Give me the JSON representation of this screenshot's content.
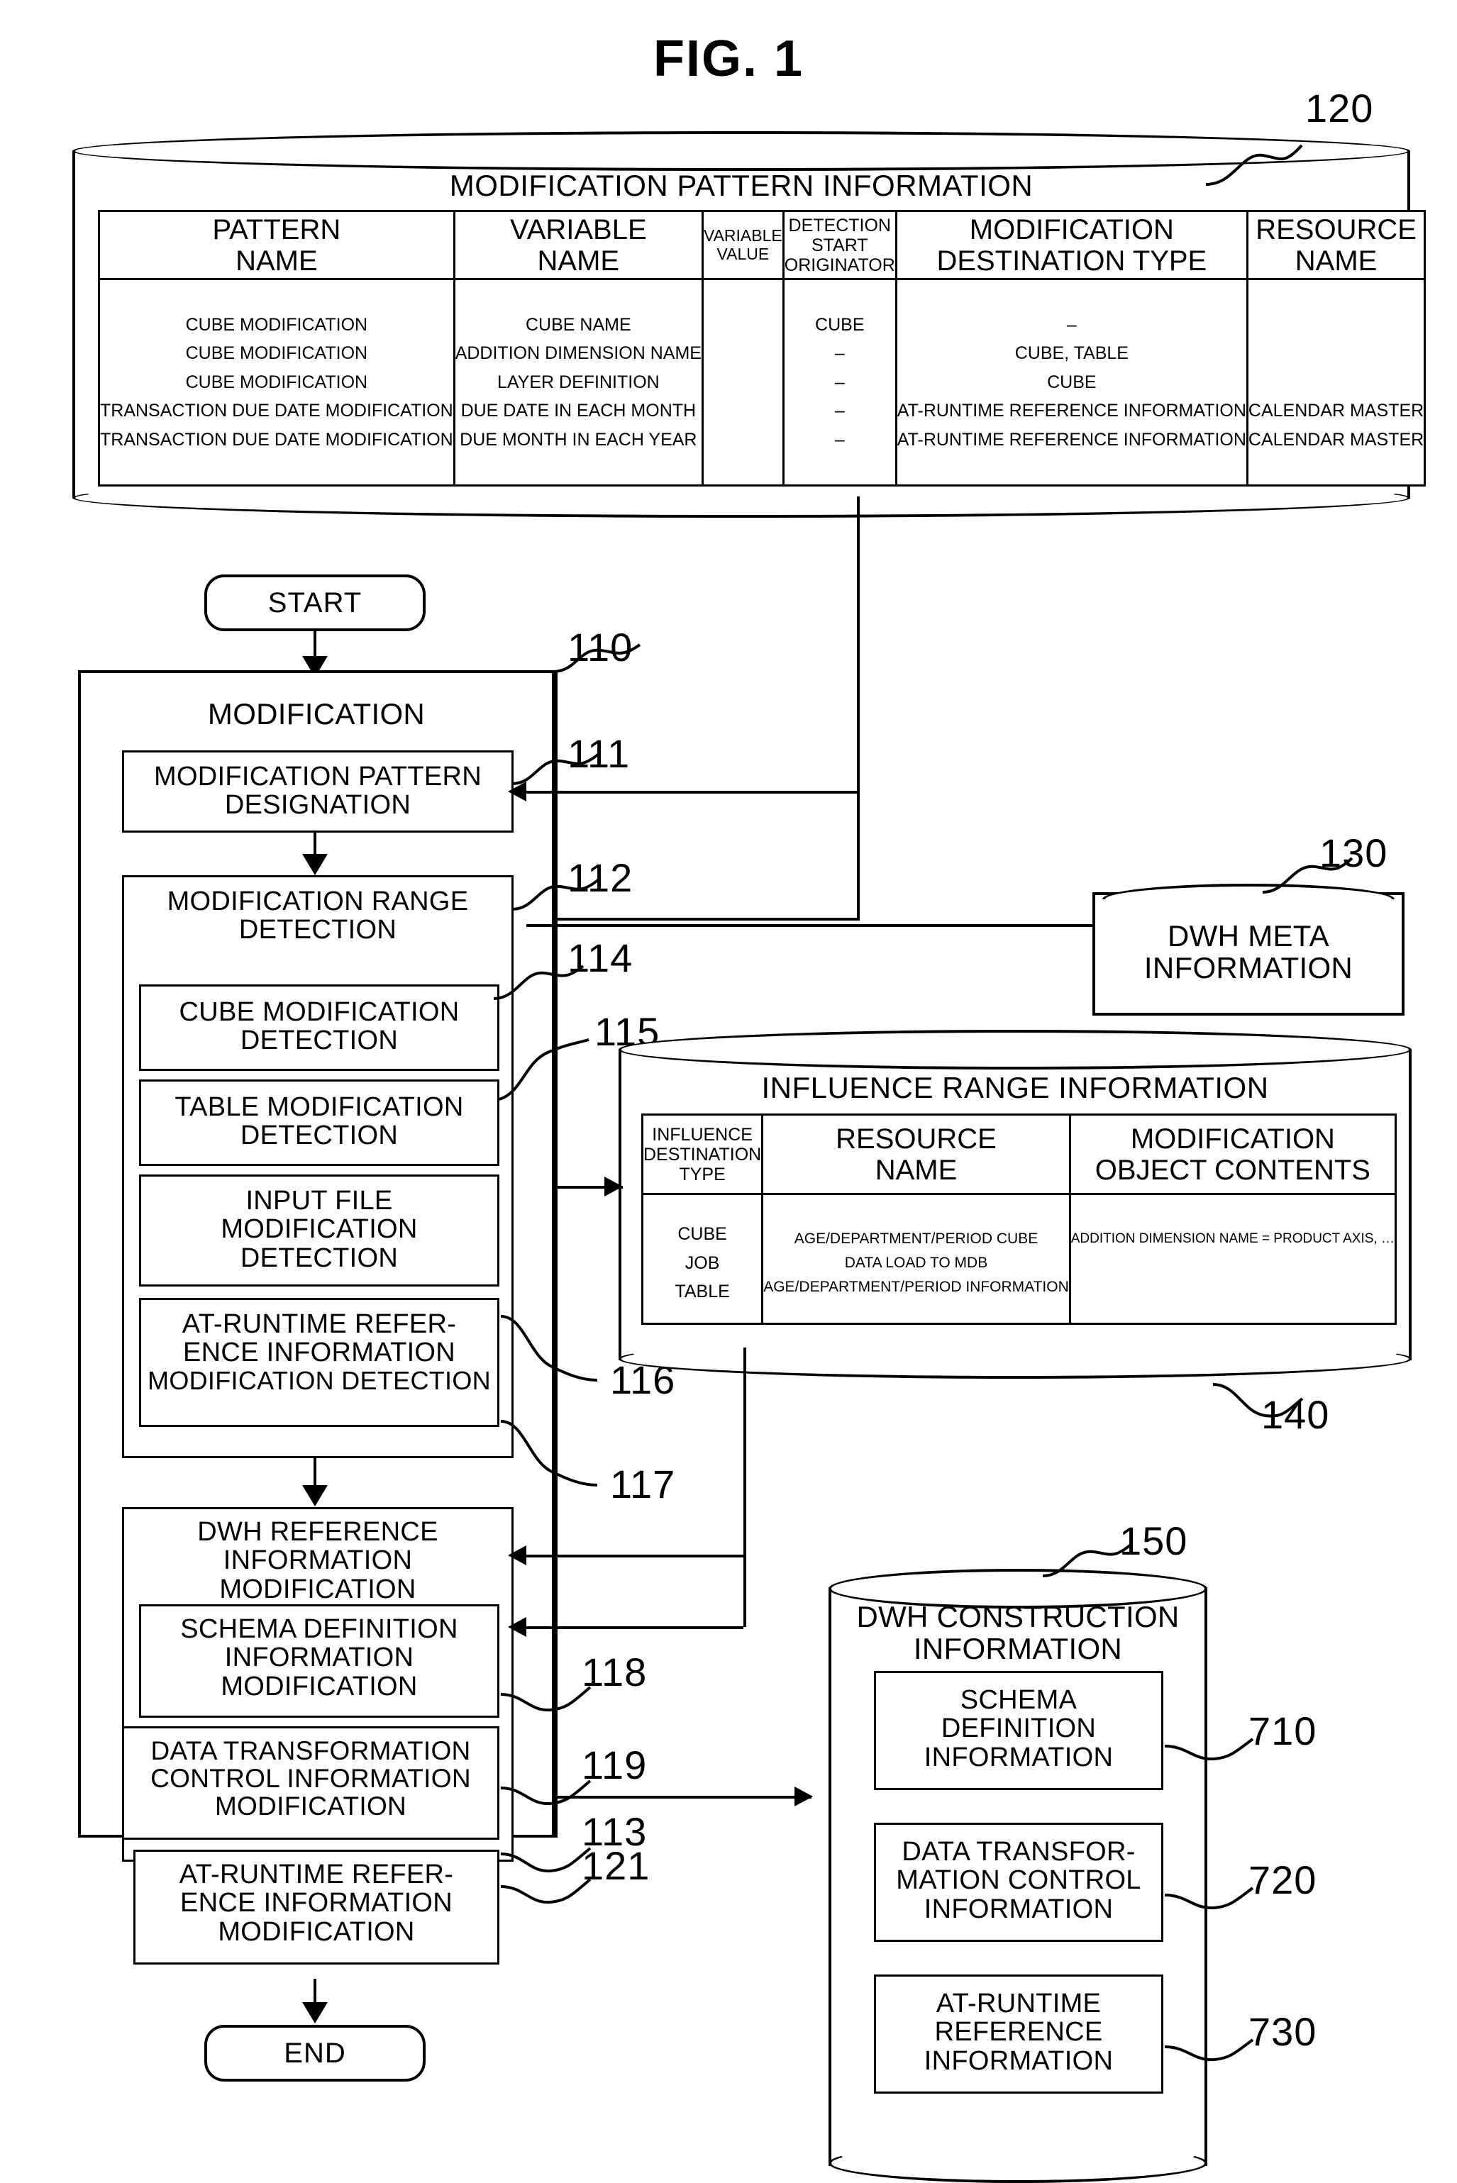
{
  "figure": {
    "title": "FIG. 1"
  },
  "modification_pattern_store": {
    "ref": "120",
    "title": "MODIFICATION PATTERN INFORMATION",
    "columns": [
      "PATTERN NAME",
      "VARIABLE NAME",
      "VARIABLE VALUE",
      "DETECTION START ORIGINATOR",
      "MODIFICATION DESTINATION TYPE",
      "RESOURCE NAME"
    ],
    "columns_split": [
      {
        "l1": "PATTERN",
        "l2": "NAME"
      },
      {
        "l1": "VARIABLE",
        "l2": "NAME"
      },
      {
        "l1": "VARIABLE",
        "l2": "VALUE"
      },
      {
        "l1": "DETECTION START",
        "l2": "ORIGINATOR"
      },
      {
        "l1": "MODIFICATION",
        "l2": "DESTINATION TYPE"
      },
      {
        "l1": "RESOURCE",
        "l2": "NAME"
      }
    ],
    "rows": [
      {
        "pattern_name": "CUBE MODIFICATION",
        "variable_name": "CUBE NAME",
        "variable_value": "",
        "detection_start_originator": "CUBE",
        "modification_destination_type": "–",
        "resource_name": ""
      },
      {
        "pattern_name": "CUBE MODIFICATION",
        "variable_name": "ADDITION DIMENSION NAME",
        "variable_value": "",
        "detection_start_originator": "–",
        "modification_destination_type": "CUBE, TABLE",
        "resource_name": ""
      },
      {
        "pattern_name": "CUBE MODIFICATION",
        "variable_name": "LAYER DEFINITION",
        "variable_value": "",
        "detection_start_originator": "–",
        "modification_destination_type": "CUBE",
        "resource_name": ""
      },
      {
        "pattern_name": "TRANSACTION DUE DATE MODIFICATION",
        "variable_name": "DUE DATE IN EACH MONTH",
        "variable_value": "",
        "detection_start_originator": "–",
        "modification_destination_type": "AT-RUNTIME REFERENCE INFORMATION",
        "resource_name": "CALENDAR MASTER"
      },
      {
        "pattern_name": "TRANSACTION DUE DATE MODIFICATION",
        "variable_name": "DUE MONTH IN EACH YEAR",
        "variable_value": "",
        "detection_start_originator": "–",
        "modification_destination_type": "AT-RUNTIME REFERENCE INFORMATION",
        "resource_name": "CALENDAR MASTER"
      }
    ]
  },
  "flow": {
    "start_label": "START",
    "end_label": "END",
    "modification_process": {
      "ref": "110",
      "title": "MODIFICATION",
      "steps": [
        {
          "ref": "111",
          "label_l1": "MODIFICATION PATTERN",
          "label_l2": "DESIGNATION"
        },
        {
          "ref": "112",
          "label_l1": "MODIFICATION RANGE",
          "label_l2": "DETECTION"
        }
      ],
      "detection_substeps": [
        {
          "ref": "114",
          "lines": [
            "CUBE MODIFICATION",
            "DETECTION"
          ]
        },
        {
          "ref": "115",
          "lines": [
            "TABLE MODIFICATION",
            "DETECTION"
          ]
        },
        {
          "ref": "116",
          "lines": [
            "INPUT FILE",
            "MODIFICATION",
            "DETECTION"
          ]
        },
        {
          "ref": "117",
          "lines": [
            "AT-RUNTIME REFER-",
            "ENCE INFORMATION",
            "MODIFICATION DETECTION"
          ]
        }
      ],
      "dwh_reference_modification": {
        "ref": "113",
        "lines": [
          "DWH REFERENCE",
          "INFORMATION",
          "MODIFICATION"
        ],
        "substeps": [
          {
            "ref": "118",
            "lines": [
              "SCHEMA DEFINITION",
              "INFORMATION",
              "MODIFICATION"
            ]
          },
          {
            "ref": "119",
            "lines": [
              "DATA TRANSFORMATION",
              "CONTROL INFORMATION",
              "MODIFICATION"
            ]
          },
          {
            "ref": "121",
            "lines": [
              "AT-RUNTIME REFER-",
              "ENCE INFORMATION",
              "MODIFICATION"
            ]
          }
        ]
      }
    }
  },
  "dwh_meta": {
    "ref": "130",
    "lines": [
      "DWH META",
      "INFORMATION"
    ]
  },
  "influence_range_store": {
    "ref": "140",
    "title": "INFLUENCE RANGE INFORMATION",
    "columns_split": [
      {
        "l1": "INFLUENCE",
        "l2": "DESTINATION TYPE"
      },
      {
        "l1": "RESOURCE",
        "l2": "NAME"
      },
      {
        "l1": "MODIFICATION",
        "l2": "OBJECT CONTENTS"
      }
    ],
    "rows": [
      {
        "influence_destination_type": "CUBE",
        "resource_name": "AGE/DEPARTMENT/PERIOD CUBE",
        "modification_object_contents": "ADDITION DIMENSION NAME = PRODUCT AXIS, …"
      },
      {
        "influence_destination_type": "JOB",
        "resource_name": "DATA LOAD TO MDB",
        "modification_object_contents": ""
      },
      {
        "influence_destination_type": "TABLE",
        "resource_name": "AGE/DEPARTMENT/PERIOD INFORMATION",
        "modification_object_contents": ""
      }
    ]
  },
  "dwh_construction_store": {
    "ref": "150",
    "title_l1": "DWH CONSTRUCTION",
    "title_l2": "INFORMATION",
    "items": [
      {
        "ref": "710",
        "lines": [
          "SCHEMA",
          "DEFINITION",
          "INFORMATION"
        ]
      },
      {
        "ref": "720",
        "lines": [
          "DATA TRANSFOR-",
          "MATION CONTROL",
          "INFORMATION"
        ]
      },
      {
        "ref": "730",
        "lines": [
          "AT-RUNTIME",
          "REFERENCE",
          "INFORMATION"
        ]
      }
    ]
  }
}
